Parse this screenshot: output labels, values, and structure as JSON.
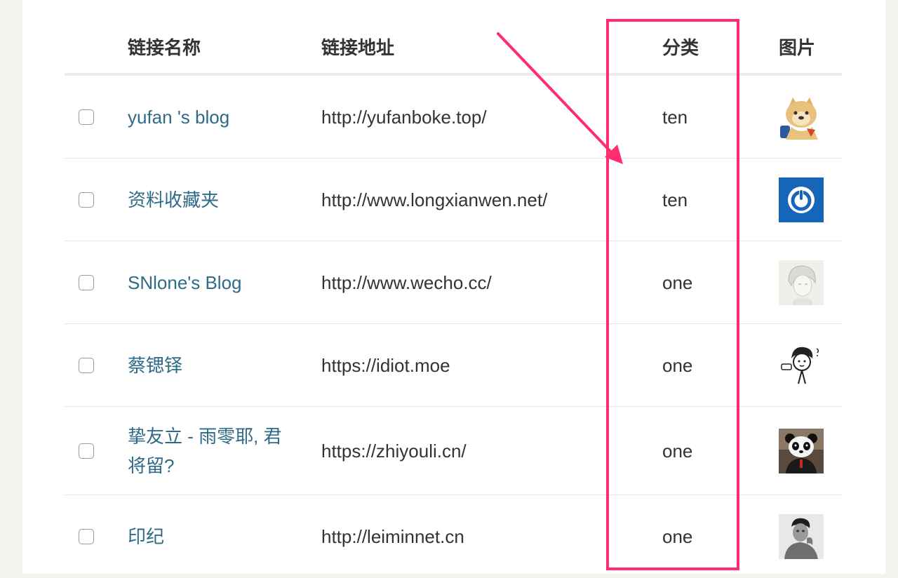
{
  "table": {
    "headers": {
      "name": "链接名称",
      "url": "链接地址",
      "category": "分类",
      "image": "图片"
    },
    "rows": [
      {
        "name": "yufan 's blog",
        "url": "http://yufanboke.top/",
        "category": "ten",
        "image": "shiba-doge-avatar"
      },
      {
        "name": "资料收藏夹",
        "url": "http://www.longxianwen.net/",
        "category": "ten",
        "image": "blue-power-avatar"
      },
      {
        "name": "SNlone's Blog",
        "url": "http://www.wecho.cc/",
        "category": "one",
        "image": "anime-sketch-avatar"
      },
      {
        "name": "蔡锶铎",
        "url": "https://idiot.moe",
        "category": "one",
        "image": "cartoon-boy-avatar"
      },
      {
        "name": "挚友立 - 雨零耶, 君将留?",
        "url": "https://zhiyouli.cn/",
        "category": "one",
        "image": "panda-avatar"
      },
      {
        "name": "印纪",
        "url": "http://leiminnet.cn",
        "category": "one",
        "image": "bw-photo-avatar"
      }
    ]
  },
  "annotation": {
    "highlight_color": "#ff2d6f"
  },
  "colors": {
    "link": "#2f6a88",
    "text": "#333333",
    "header_border": "#ececec",
    "row_border": "#e6e6e6"
  }
}
